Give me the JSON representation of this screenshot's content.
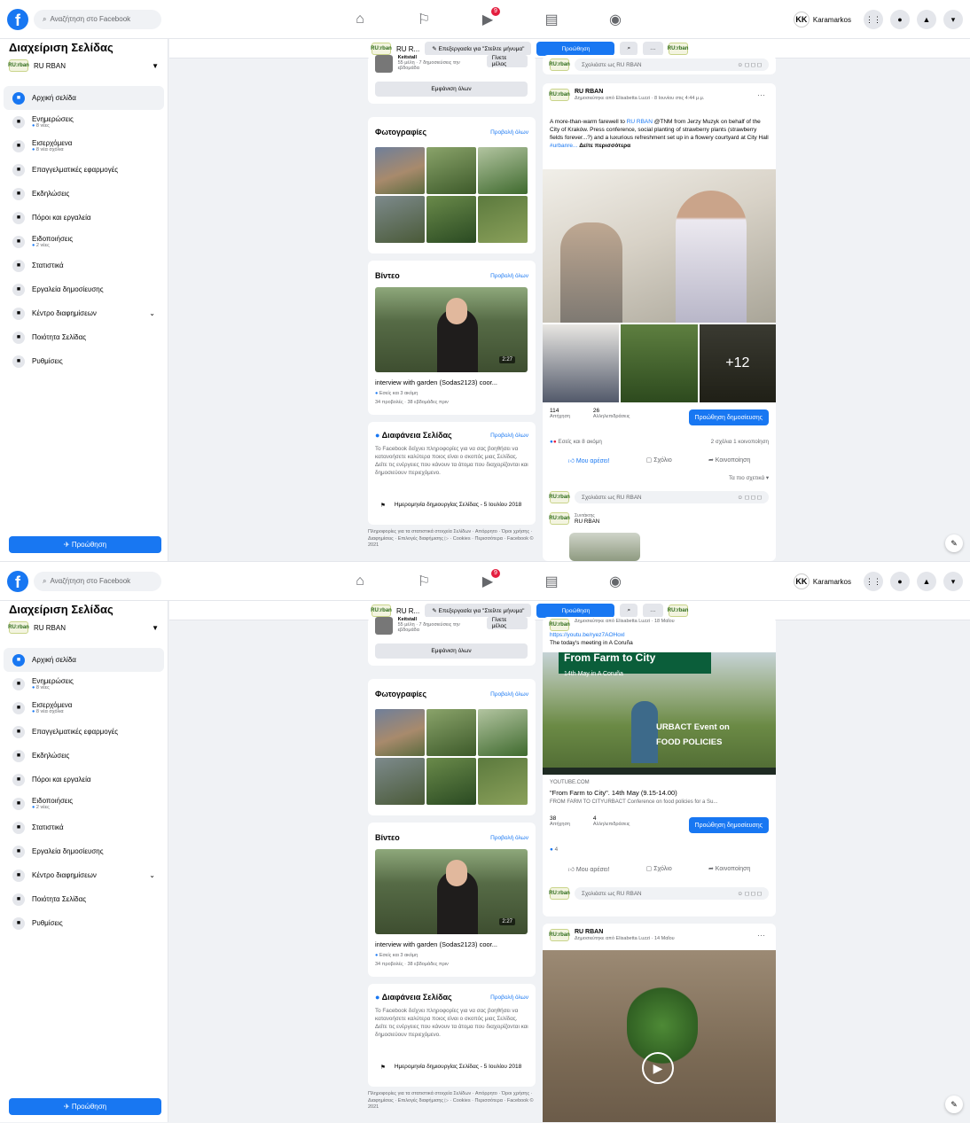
{
  "topbar": {
    "search_placeholder": "Αναζήτηση στο Facebook",
    "watch_badge": "9",
    "profile_initials": "KK",
    "profile_name": "Karamarkos"
  },
  "sidebar": {
    "title": "Διαχείριση Σελίδας",
    "page_name": "RU RBAN",
    "page_logo_text": "RU:rban",
    "items": [
      {
        "label": "Αρχική σελίδα",
        "sub": "",
        "icon": "home-icon"
      },
      {
        "label": "Ενημερώσεις",
        "sub": "8 νέες",
        "icon": "inbox-icon"
      },
      {
        "label": "Εισερχόμενα",
        "sub": "8 νέα σχόλια",
        "icon": "chat-icon"
      },
      {
        "label": "Επαγγελματικές εφαρμογές",
        "sub": "",
        "icon": "apps-icon"
      },
      {
        "label": "Εκδηλώσεις",
        "sub": "",
        "icon": "calendar-icon"
      },
      {
        "label": "Πόροι και εργαλεία",
        "sub": "",
        "icon": "info-icon"
      },
      {
        "label": "Ειδοποιήσεις",
        "sub": "2 νέες",
        "icon": "bell-icon"
      },
      {
        "label": "Στατιστικά",
        "sub": "",
        "icon": "chart-icon"
      },
      {
        "label": "Εργαλεία δημοσίευσης",
        "sub": "",
        "icon": "publish-icon"
      },
      {
        "label": "Κέντρο διαφημίσεων",
        "sub": "",
        "icon": "megaphone-icon"
      },
      {
        "label": "Ποιότητα Σελίδας",
        "sub": "",
        "icon": "quality-icon"
      },
      {
        "label": "Ρυθμίσεις",
        "sub": "",
        "icon": "gear-icon"
      }
    ],
    "promote_label": "Προώθηση"
  },
  "pagebar": {
    "page_short": "RU R...",
    "edit_label": "Επεξεργασία για \"Στείλτε μήνυμα\"",
    "promote_label": "Προώθηση",
    "more_label": "···"
  },
  "leftcol": {
    "member_name": "Keitstall",
    "member_meta": "55 μέλη · 7 δημοσιεύσεις την εβδομάδα",
    "join_label": "Γίνετε μέλος",
    "show_all_label": "Εμφάνιση όλων",
    "photos_title": "Φωτογραφίες",
    "photos_more": "Προβολή όλων",
    "videos_title": "Βίντεο",
    "videos_more": "Προβολή όλων",
    "video_duration": "2:27",
    "video_title": "interview with garden (Sodas2123) coor...",
    "video_reactions": "Εσείς και 3 ακόμη",
    "video_meta": "34 προβολές · 38 εβδομάδες πριν",
    "transparency_title": "Διαφάνεια Σελίδας",
    "transparency_more": "Προβολή όλων",
    "transparency_text": "Το Facebook δείχνει πληροφορίες για να σας βοηθήσει να κατανοήσετε καλύτερα ποιος είναι ο σκοπός μιας Σελίδας. Δείτε τις ενέργειες που κάνουν τα άτομα που διαχειρίζονται και δημοσιεύουν περιεχόμενο.",
    "creation_date": "Ημερομηνία δημιουργίας Σελίδας - 5 Ιουλίου 2018",
    "footer": "Πληροφορίες για τα στατιστικά στοιχεία Σελίδων · Απόρρητο · Όροι χρήσης · Διαφημίσεις · Επιλογές διαφήμισης ▷ · Cookies · Περισσότερα · Facebook © 2021"
  },
  "screen1": {
    "comment_placeholder": "Σχολιάστε ως RU RBAN",
    "post": {
      "author": "RU RBAN",
      "meta": "Δημοσιεύτηκε από Elisabetta Luzzi · 8 Ιουνίου στις 4:44 μ.μ.",
      "text_before": "A more-than-warm farewell to ",
      "text_link": "RU RBAN",
      "text_after": " @TNM from Jerzy Muzyk on behalf of the City of Kraków. Press conference, social planting of strawberry plants (strawberry fields forever...?) and a luxurious refreshment set up in a flowery courtyard at City Hall ",
      "hashtag": "#urbanre...",
      "see_more": "Δείτε περισσότερα",
      "plus_photos": "+12",
      "reach": "114",
      "reach_label": "Απήχηση",
      "engagement": "26",
      "engagement_label": "Αλληλεπιδράσεις",
      "boost_label": "Προώθηση δημοσίευσης",
      "reactions": "Εσείς και 8 ακόμη",
      "comments_shares": "2 σχόλια  1 κοινοποίηση",
      "like": "Μου αρέσει!",
      "comment": "Σχόλιο",
      "share": "Κοινοποίηση",
      "sort": "Τα πιο σχετικά ▾",
      "reply_role": "Συντάκτης",
      "reply_name": "RU RBAN"
    }
  },
  "screen2": {
    "post1": {
      "meta": "Δημοσιεύτηκε από Elisabetta Luzzi · 18 Μαΐου",
      "link": "https://youtu.be/ryez7AOHoxl",
      "text": "The today's meeting in A Coruña",
      "banner_title": "From Farm to City",
      "banner_sub": "14th May in A Coruña",
      "event_line1": "URBACT Event on",
      "event_line2": "FOOD POLICIES",
      "domain": "YOUTUBE.COM",
      "title": "\"From Farm to City\". 14th May (9.15-14.00)",
      "desc": "FROM FARM TO CITYURBACT Conference on food policies for a Su...",
      "reach": "38",
      "reach_label": "Απήχηση",
      "engagement": "4",
      "engagement_label": "Αλληλεπιδράσεις",
      "boost_label": "Προώθηση δημοσίευσης",
      "reactions": "4",
      "like": "Μου αρέσει!",
      "comment": "Σχόλιο",
      "share": "Κοινοποίηση",
      "comment_placeholder": "Σχολιάστε ως RU RBAN"
    },
    "post2": {
      "author": "RU RBAN",
      "meta": "Δημοσιεύτηκε από Elisabetta Luzzi · 14 Μαΐου"
    }
  }
}
